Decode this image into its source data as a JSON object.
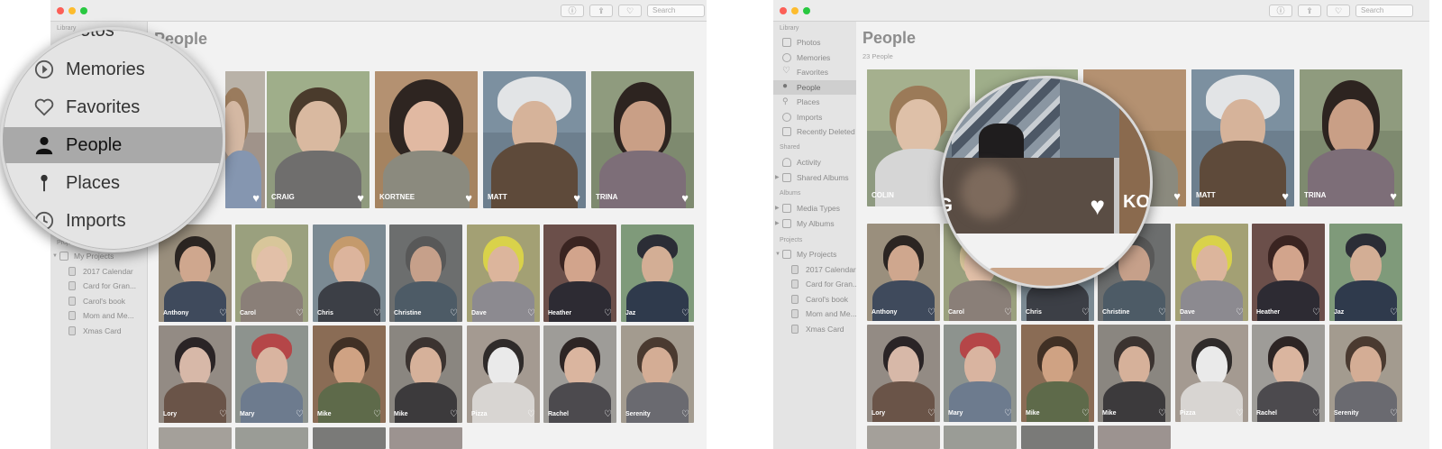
{
  "left": {
    "toolbar": {
      "info_label": "ⓘ",
      "share_label": "⇪",
      "heart_label": "♡",
      "search_placeholder": "Search"
    },
    "sidebar": {
      "library_label": "Library",
      "projects_label": "Projects",
      "projects": {
        "my_projects": "My Projects",
        "items": [
          "2017 Calendar",
          "Card for Gran...",
          "Carol's book",
          "Mom and Me...",
          "Xmas Card"
        ]
      }
    },
    "main": {
      "title": "People"
    },
    "magnifier": {
      "title_fragment": "otos",
      "items": [
        "Memories",
        "Favorites",
        "People",
        "Places",
        "Imports"
      ],
      "selected": "People"
    },
    "featured": [
      "CRAIG",
      "KORTNEE",
      "MATT",
      "TRINA"
    ],
    "row1": [
      "Anthony",
      "Carol",
      "Chris",
      "Christine",
      "Dave",
      "Heather",
      "Jaz"
    ],
    "row2": [
      "Lory",
      "Mary",
      "Mike",
      "Mike",
      "Pizza",
      "Rachel",
      "Serenity"
    ]
  },
  "right": {
    "toolbar": {
      "info_label": "ⓘ",
      "share_label": "⇪",
      "heart_label": "♡",
      "search_placeholder": "Search"
    },
    "sidebar": {
      "library_label": "Library",
      "library_items": [
        "Photos",
        "Memories",
        "Favorites",
        "People",
        "Places",
        "Imports",
        "Recently Deleted"
      ],
      "selected": "People",
      "shared_label": "Shared",
      "shared_items": [
        "Activity",
        "Shared Albums"
      ],
      "albums_label": "Albums",
      "albums_items": [
        "Media Types",
        "My Albums"
      ],
      "projects_label": "Projects",
      "projects": {
        "my_projects": "My Projects",
        "items": [
          "2017 Calendar",
          "Card for Gran...",
          "Carol's book",
          "Mom and Me...",
          "Xmas Card"
        ]
      }
    },
    "main": {
      "title": "People",
      "count": "23 People"
    },
    "featured": [
      "COLIN",
      "",
      "",
      "MATT",
      "TRINA"
    ],
    "row1": [
      "Anthony",
      "Carol",
      "Chris",
      "Christine",
      "Dave",
      "Heather",
      "Jaz"
    ],
    "row2": [
      "Lory",
      "Mary",
      "Mike",
      "Mike",
      "Pizza",
      "Rachel",
      "Serenity"
    ],
    "magnifier": {
      "name_fragment_left": "G",
      "name_fragment_right": "KO"
    }
  },
  "colors": {
    "close": "#fc5f57",
    "minimize": "#fdbc2e",
    "zoom": "#28c840",
    "selection": "#cfcfcf",
    "magnifier_selection": "#a9a9a9"
  }
}
